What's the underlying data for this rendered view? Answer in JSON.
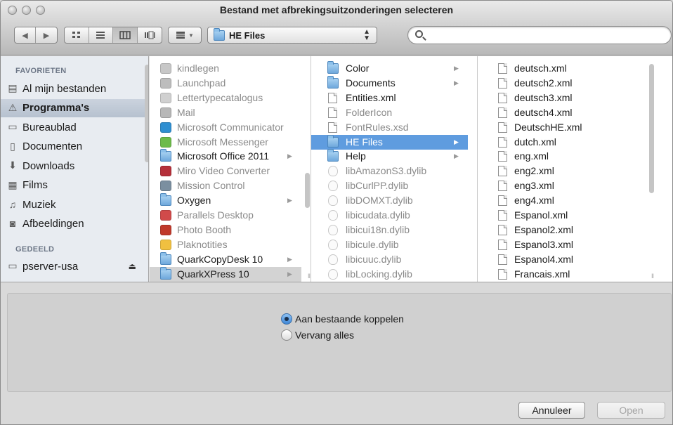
{
  "window": {
    "title": "Bestand met afbrekingsuitzonderingen selecteren"
  },
  "toolbar": {
    "path_popup": "HE Files",
    "search": {
      "value": "",
      "placeholder": ""
    }
  },
  "sidebar": {
    "favorites_header": "FAVORIETEN",
    "favorites": [
      {
        "label": "Al mijn bestanden",
        "icon": "all-files-icon"
      },
      {
        "label": "Programma's",
        "icon": "applications-icon",
        "selected": true
      },
      {
        "label": "Bureaublad",
        "icon": "desktop-icon"
      },
      {
        "label": "Documenten",
        "icon": "documents-icon"
      },
      {
        "label": "Downloads",
        "icon": "downloads-icon"
      },
      {
        "label": "Films",
        "icon": "movies-icon"
      },
      {
        "label": "Muziek",
        "icon": "music-icon"
      },
      {
        "label": "Afbeeldingen",
        "icon": "pictures-icon"
      }
    ],
    "shared_header": "GEDEELD",
    "shared": [
      {
        "label": "pserver-usa",
        "icon": "server-icon"
      }
    ]
  },
  "columns": {
    "applications": [
      {
        "name": "kindlegen",
        "enabled": false
      },
      {
        "name": "Launchpad",
        "enabled": false
      },
      {
        "name": "Lettertypecatalogus",
        "enabled": false
      },
      {
        "name": "Mail",
        "enabled": false
      },
      {
        "name": "Microsoft Communicator",
        "enabled": false
      },
      {
        "name": "Microsoft Messenger",
        "enabled": false
      },
      {
        "name": "Microsoft Office 2011",
        "enabled": true,
        "folder": true
      },
      {
        "name": "Miro Video Converter",
        "enabled": false
      },
      {
        "name": "Mission Control",
        "enabled": false
      },
      {
        "name": "Oxygen",
        "enabled": true,
        "folder": true
      },
      {
        "name": "Parallels Desktop",
        "enabled": false
      },
      {
        "name": "Photo Booth",
        "enabled": false
      },
      {
        "name": "Plaknotities",
        "enabled": false
      },
      {
        "name": "QuarkCopyDesk 10",
        "enabled": true,
        "folder": true
      },
      {
        "name": "QuarkXPress 10",
        "enabled": true,
        "folder": true,
        "selected": true
      }
    ],
    "quark_folder": [
      {
        "name": "Color",
        "enabled": true,
        "folder": true
      },
      {
        "name": "Documents",
        "enabled": true,
        "folder": true
      },
      {
        "name": "Entities.xml",
        "enabled": true
      },
      {
        "name": "FolderIcon",
        "enabled": false
      },
      {
        "name": "FontRules.xsd",
        "enabled": false
      },
      {
        "name": "HE Files",
        "enabled": true,
        "folder": true,
        "selected": true
      },
      {
        "name": "Help",
        "enabled": true,
        "folder": true
      },
      {
        "name": "libAmazonS3.dylib",
        "enabled": false
      },
      {
        "name": "libCurlPP.dylib",
        "enabled": false
      },
      {
        "name": "libDOMXT.dylib",
        "enabled": false
      },
      {
        "name": "libicudata.dylib",
        "enabled": false
      },
      {
        "name": "libicui18n.dylib",
        "enabled": false
      },
      {
        "name": "libicule.dylib",
        "enabled": false
      },
      {
        "name": "libicuuc.dylib",
        "enabled": false
      },
      {
        "name": "libLocking.dylib",
        "enabled": false
      }
    ],
    "he_files": [
      "deutsch.xml",
      "deutsch2.xml",
      "deutsch3.xml",
      "deutsch4.xml",
      "DeutschHE.xml",
      "dutch.xml",
      "eng.xml",
      "eng2.xml",
      "eng3.xml",
      "eng4.xml",
      "Espanol.xml",
      "Espanol2.xml",
      "Espanol3.xml",
      "Espanol4.xml",
      "Francais.xml"
    ]
  },
  "options": {
    "radio_link": "Aan bestaande koppelen",
    "radio_replace": "Vervang alles",
    "selected": "link"
  },
  "buttons": {
    "cancel": "Annuleer",
    "open": "Open"
  }
}
